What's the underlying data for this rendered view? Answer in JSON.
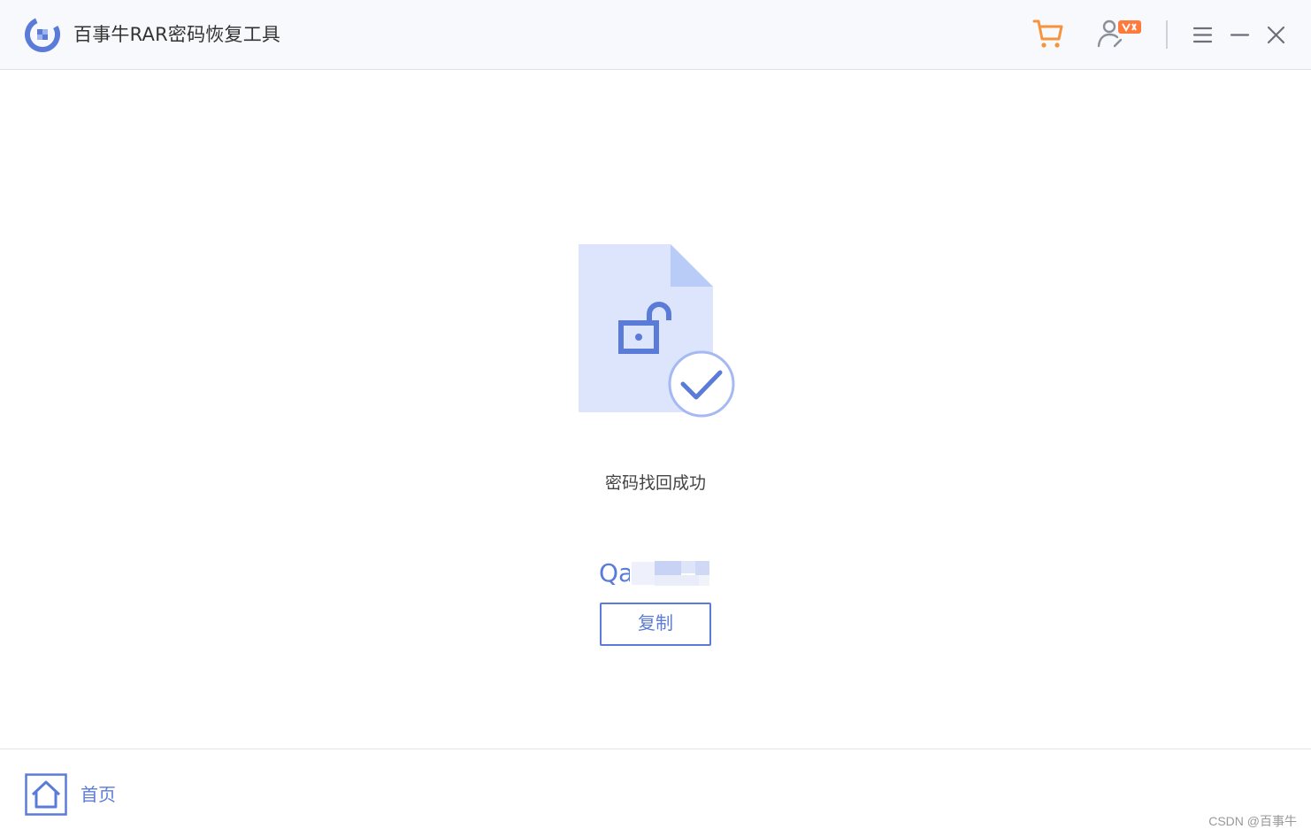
{
  "window": {
    "title": "百事牛RAR密码恢复工具"
  },
  "titlebar": {
    "icons": [
      "logo-icon",
      "cart-icon",
      "user-vip-icon",
      "menu-icon",
      "minimize-icon",
      "close-icon"
    ]
  },
  "result": {
    "status": "密码找回成功",
    "password_visible": "Qa",
    "copy_label": "复制"
  },
  "footer": {
    "home_label": "首页"
  },
  "watermark": "CSDN @百事牛",
  "colors": {
    "accent": "#5b7bd8",
    "cart": "#f5943d",
    "vip_badge": "#ff7a3d",
    "doc_fill": "#dce5fc",
    "doc_fold": "#b9cbf7"
  }
}
